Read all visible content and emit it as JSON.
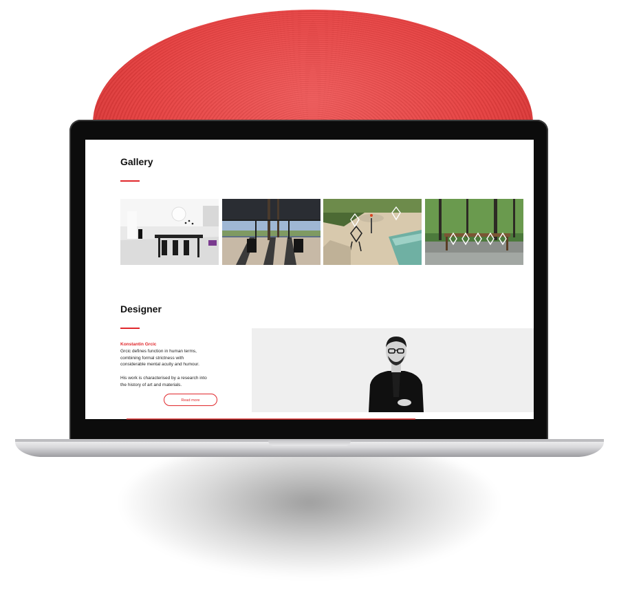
{
  "gallery": {
    "title": "Gallery",
    "images": [
      {
        "alt": "white interior with black dining set"
      },
      {
        "alt": "terrace with tree shadows and chairs"
      },
      {
        "alt": "poolside deck with white chairs"
      },
      {
        "alt": "forest patio with table and chairs"
      }
    ]
  },
  "designer": {
    "title": "Designer",
    "name": "Konstantin Grcic",
    "description_lines": [
      "Grcic defines function in human terms,",
      "combining formal strictness with",
      "considerable mental acuity and humour."
    ],
    "research_lines": [
      "His work is characterised by a research into",
      "the history of art and materials."
    ],
    "read_more_label": "Read more"
  },
  "colors": {
    "accent": "#e0262a",
    "disc": "#e53f3f",
    "photo_background": "#efefef"
  }
}
